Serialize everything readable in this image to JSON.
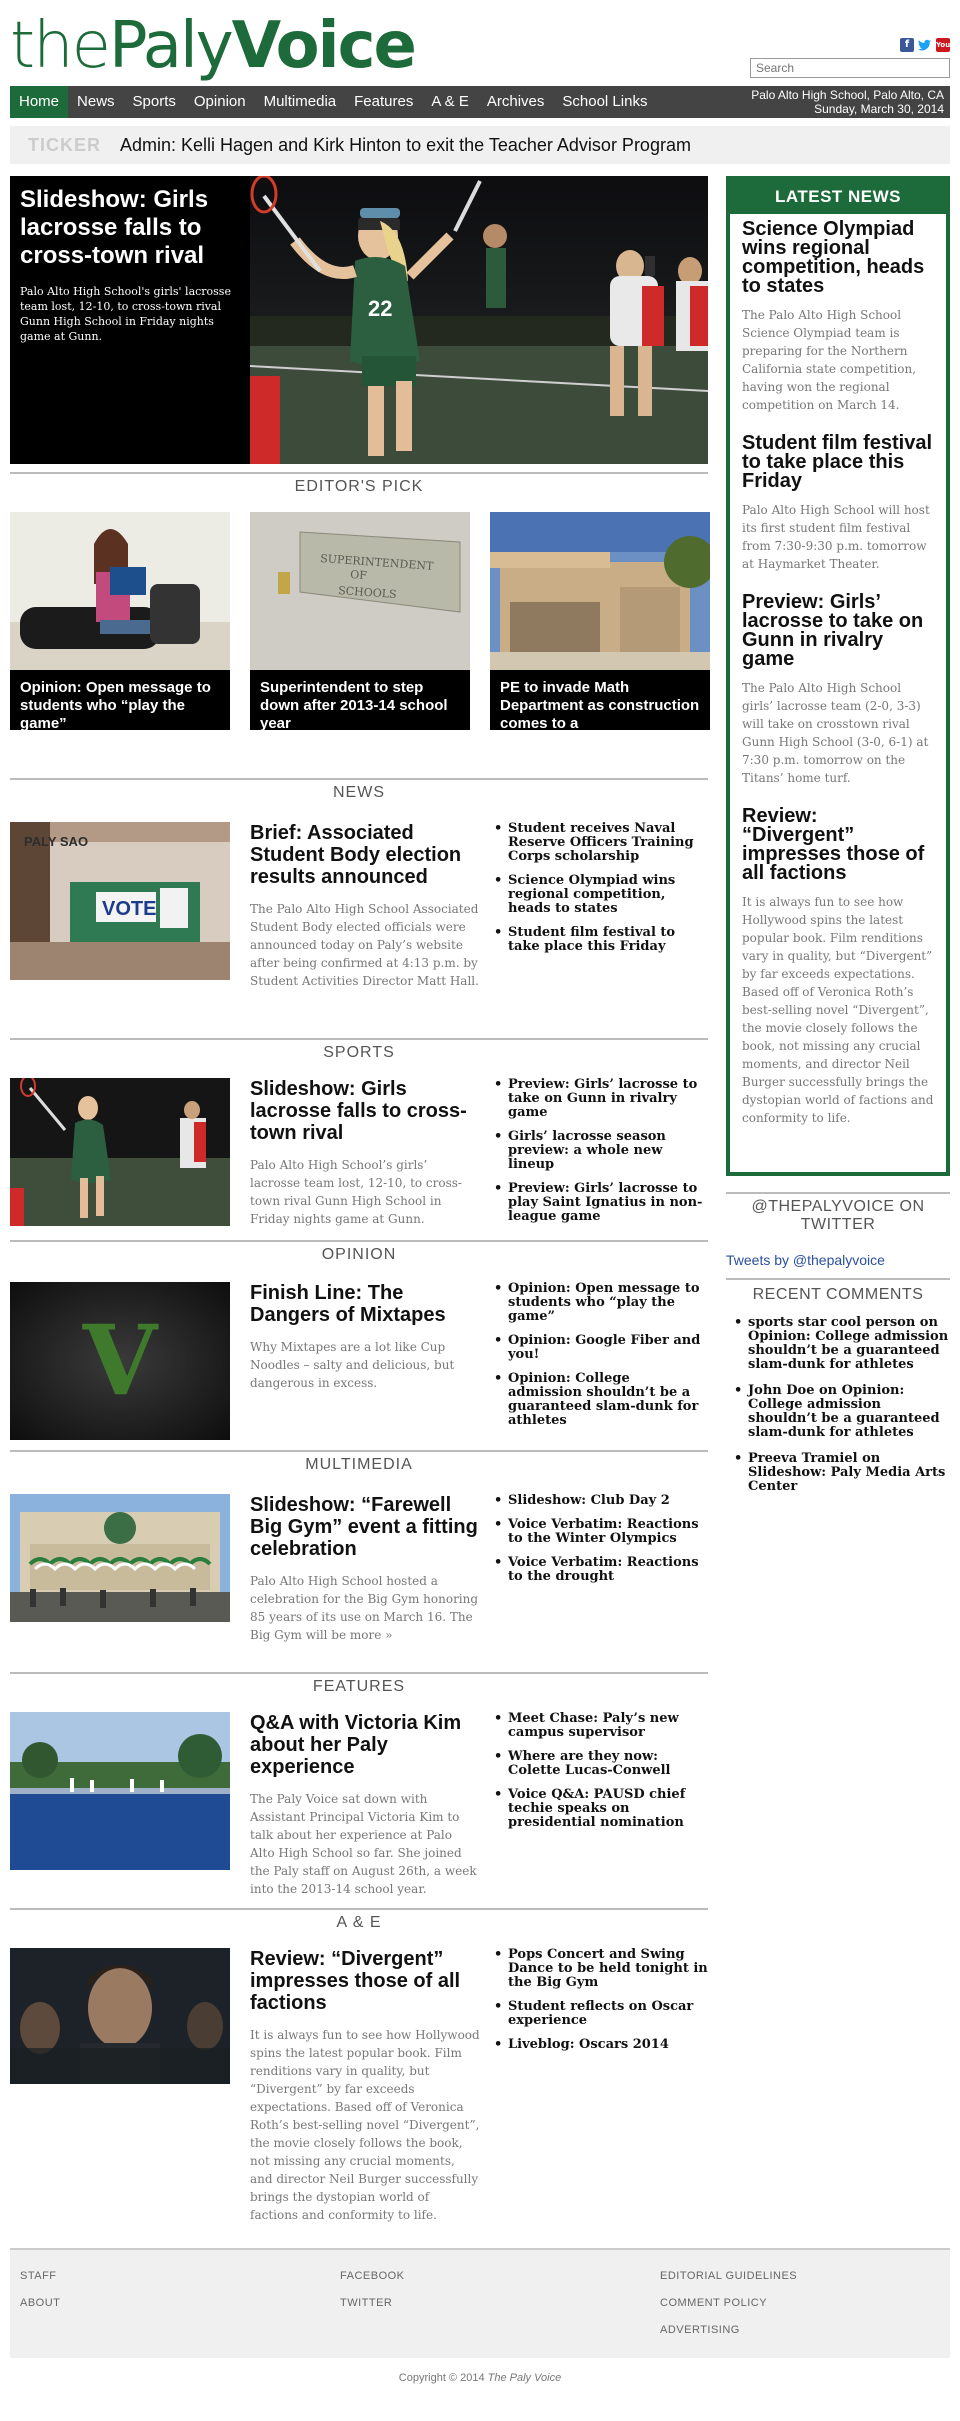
{
  "header": {
    "logo_the": "the",
    "logo_paly": "Paly",
    "logo_voice": "Voice",
    "search_placeholder": "Search",
    "social": [
      {
        "icon": "facebook-icon",
        "glyph": "f"
      },
      {
        "icon": "twitter-icon",
        "glyph": "🐦"
      },
      {
        "icon": "youtube-icon",
        "glyph": "You"
      }
    ]
  },
  "nav": {
    "items": [
      "Home",
      "News",
      "Sports",
      "Opinion",
      "Multimedia",
      "Features",
      "A & E",
      "Archives",
      "School Links"
    ],
    "location": "Palo Alto High School, Palo Alto, CA",
    "date": "Sunday, March 30, 2014"
  },
  "ticker": {
    "label": "TICKER",
    "text": "Admin: Kelli Hagen and Kirk Hinton to exit the Teacher Advisor Program"
  },
  "hero": {
    "title": "Slideshow: Girls lacrosse falls to cross-town rival",
    "blurb": "Palo Alto High School's girls' lacrosse team lost, 12-10, to cross-town rival Gunn High School in Friday nights game at Gunn."
  },
  "editors_pick": {
    "heading": "EDITOR'S PICK",
    "items": [
      {
        "caption": "Opinion: Open message to students who “play the game”"
      },
      {
        "caption": "Superintendent to step down after 2013-14 school year",
        "sign": "SUPERINTENDENT OF SCHOOLS"
      },
      {
        "caption": "PE to invade Math Department as construction comes to a"
      }
    ]
  },
  "sections": {
    "news": {
      "heading": "NEWS",
      "title": "Brief: Associated Student Body election results announced",
      "blurb": "The Palo Alto High School Associated Student Body elected officials were announced today on Paly’s website after being confirmed at 4:13 p.m. by Student Activities Director Matt Hall.",
      "links": [
        "Student receives Naval Reserve Officers Training Corps scholarship",
        "Science Olympiad wins regional competition, heads to states",
        "Student film festival to take place this Friday"
      ],
      "img_text": {
        "sign": "PALY SAO",
        "vote": "VOTE"
      }
    },
    "sports": {
      "heading": "SPORTS",
      "title": "Slideshow: Girls lacrosse falls to cross-town rival",
      "blurb": "Palo Alto High School’s girls’ lacrosse team lost, 12-10, to cross-town rival Gunn High School in Friday nights game at Gunn.",
      "links": [
        "Preview: Girls’ lacrosse to take on Gunn in rivalry game",
        "Girls’ lacrosse season preview: a whole new lineup",
        "Preview: Girls’ lacrosse to play Saint Ignatius in non-league game"
      ]
    },
    "opinion": {
      "heading": "OPINION",
      "title": "Finish Line: The Dangers of Mixtapes",
      "blurb": "Why Mixtapes are a lot like Cup Noodles – salty and delicious, but dangerous in excess.",
      "links": [
        "Opinion: Open message to students who “play the game”",
        "Opinion: Google Fiber and you!",
        "Opinion: College admission shouldn’t be a guaranteed slam-dunk for athletes"
      ],
      "img_letter": "V"
    },
    "multimedia": {
      "heading": "MULTIMEDIA",
      "title": "Slideshow: “Farewell Big Gym” event a fitting celebration",
      "blurb": "Palo Alto High School hosted a celebration for the Big Gym honoring 85 years of its use on March 16. The Big Gym will be more »",
      "links": [
        "Slideshow: Club Day 2",
        "Voice Verbatim: Reactions to the Winter Olympics",
        "Voice Verbatim: Reactions to the drought"
      ]
    },
    "features": {
      "heading": "FEATURES",
      "title": "Q&A with Victoria Kim about her Paly experience",
      "blurb": "The Paly Voice sat down with Assistant Principal Victoria Kim to talk about her experience at Palo Alto High School so far. She joined the Paly staff on August 26th, a week into the 2013-14 school year.",
      "links": [
        "Meet Chase: Paly’s new campus supervisor",
        "Where are they now: Colette Lucas-Conwell",
        "Voice Q&A: PAUSD chief techie speaks on presidential nomination"
      ]
    },
    "ae": {
      "heading": "A & E",
      "title": "Review: “Divergent” impresses those of all factions",
      "blurb": "It is always fun to see how Hollywood spins the latest popular book. Film renditions vary in quality, but “Divergent” by far exceeds expectations. Based off of Veronica Roth’s best-selling novel “Divergent”, the movie closely follows the book, not missing any crucial moments, and director Neil Burger successfully brings the dystopian world of factions and conformity to life.",
      "links": [
        "Pops Concert and Swing Dance to be held tonight in the Big Gym",
        "Student reflects on Oscar experience",
        "Liveblog: Oscars 2014"
      ]
    }
  },
  "latest_news": {
    "heading": "LATEST NEWS",
    "items": [
      {
        "title": "Science Olympiad wins regional competition, heads to states",
        "blurb": "The Palo Alto High School Science Olympiad team is preparing for the Northern California state competition, having won the regional competition on March 14."
      },
      {
        "title": "Student film festival to take place this Friday",
        "blurb": "Palo Alto High School will host its first student film festival from 7:30-9:30 p.m. tomorrow at Haymarket Theater."
      },
      {
        "title": "Preview: Girls’ lacrosse to take on Gunn in rivalry game",
        "blurb": "The Palo Alto High School girls’ lacrosse team (2-0, 3-3) will take on crosstown rival Gunn High School (3-0, 6-1) at 7:30 p.m. tomorrow on the Titans’ home turf."
      },
      {
        "title": "Review: “Divergent” impresses those of all factions",
        "blurb": "It is always fun to see how Hollywood spins the latest popular book. Film renditions vary in quality, but “Divergent” by far exceeds expectations. Based off of Veronica Roth’s best-selling novel “Divergent”, the movie closely follows the book, not missing any crucial moments, and director Neil Burger successfully brings the dystopian world of factions and conformity to life."
      }
    ]
  },
  "twitter": {
    "heading": "@THEPALYVOICE ON TWITTER",
    "link": "Tweets by @thepalyvoice"
  },
  "recent_comments": {
    "heading": "RECENT COMMENTS",
    "items": [
      "sports star cool person on Opinion: College admission shouldn’t be a guaranteed slam-dunk for athletes",
      "John Doe on Opinion: College admission shouldn’t be a guaranteed slam-dunk for athletes",
      "Preeva Tramiel on Slideshow: Paly Media Arts Center"
    ]
  },
  "footer": {
    "col1": [
      "STAFF",
      "ABOUT"
    ],
    "col2": [
      "FACEBOOK",
      "TWITTER"
    ],
    "col3": [
      "EDITORIAL GUIDELINES",
      "COMMENT POLICY",
      "ADVERTISING"
    ],
    "copyright_prefix": "Copyright © 2014",
    "copyright_name": "The Paly Voice"
  },
  "colors": {
    "brand_green": "#1d6b3a",
    "nav_bg": "#444444",
    "ticker_bg": "#f0f0f0"
  }
}
